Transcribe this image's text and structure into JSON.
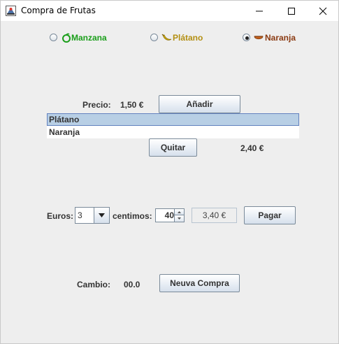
{
  "window": {
    "title": "Compra de Frutas"
  },
  "fruits": [
    {
      "label": "Manzana",
      "color": "#1a9e1a",
      "icon": "apple-icon",
      "selected": false
    },
    {
      "label": "Plátano",
      "color": "#b38f12",
      "icon": "banana-icon",
      "selected": false
    },
    {
      "label": "Naranja",
      "color": "#8a3a12",
      "icon": "orange-icon",
      "selected": true
    }
  ],
  "price": {
    "label": "Precio:",
    "value": "1,50 €"
  },
  "buttons": {
    "add": "Añadir",
    "remove": "Quitar",
    "pay": "Pagar",
    "new_purchase": "Neuva Compra"
  },
  "cart": {
    "items": [
      "Plátano",
      "Naranja"
    ],
    "selected_index": 0,
    "total": "2,40 €"
  },
  "payment": {
    "euros_label": "Euros:",
    "euros_value": "3",
    "cents_label": "centimos:",
    "cents_value": "40",
    "amount": "3,40 €"
  },
  "change": {
    "label": "Cambio:",
    "value": "00.0"
  }
}
